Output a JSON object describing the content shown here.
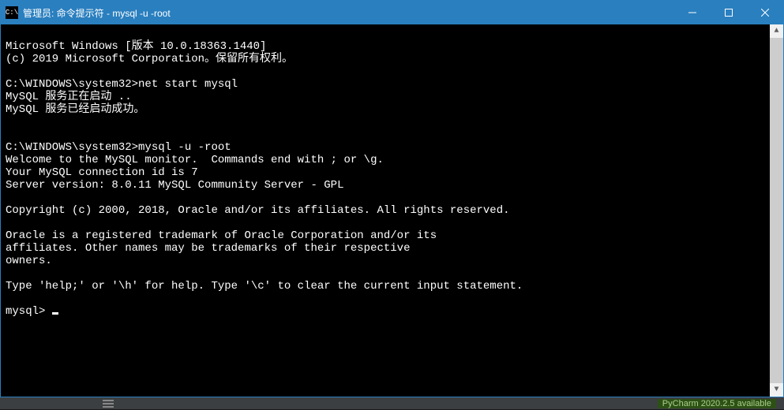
{
  "titlebar": {
    "icon_label": "C:\\",
    "title": "管理员: 命令提示符 - mysql  -u -root",
    "minimize": "—",
    "maximize": "☐",
    "close": "✕"
  },
  "terminal": {
    "line1": "Microsoft Windows [版本 10.0.18363.1440]",
    "line2": "(c) 2019 Microsoft Corporation。保留所有权利。",
    "line3": "",
    "line4": "C:\\WINDOWS\\system32>net start mysql",
    "line5": "MySQL 服务正在启动 ..",
    "line6": "MySQL 服务已经启动成功。",
    "line7": "",
    "line8": "",
    "line9": "C:\\WINDOWS\\system32>mysql -u -root",
    "line10": "Welcome to the MySQL monitor.  Commands end with ; or \\g.",
    "line11": "Your MySQL connection id is 7",
    "line12": "Server version: 8.0.11 MySQL Community Server - GPL",
    "line13": "",
    "line14": "Copyright (c) 2000, 2018, Oracle and/or its affiliates. All rights reserved.",
    "line15": "",
    "line16": "Oracle is a registered trademark of Oracle Corporation and/or its",
    "line17": "affiliates. Other names may be trademarks of their respective",
    "line18": "owners.",
    "line19": "",
    "line20": "Type 'help;' or '\\h' for help. Type '\\c' to clear the current input statement.",
    "line21": "",
    "prompt": "mysql> "
  },
  "scrollbar": {
    "up": "▲",
    "down": "▼"
  },
  "taskbar": {
    "update": "PyCharm 2020.2.5 available"
  }
}
